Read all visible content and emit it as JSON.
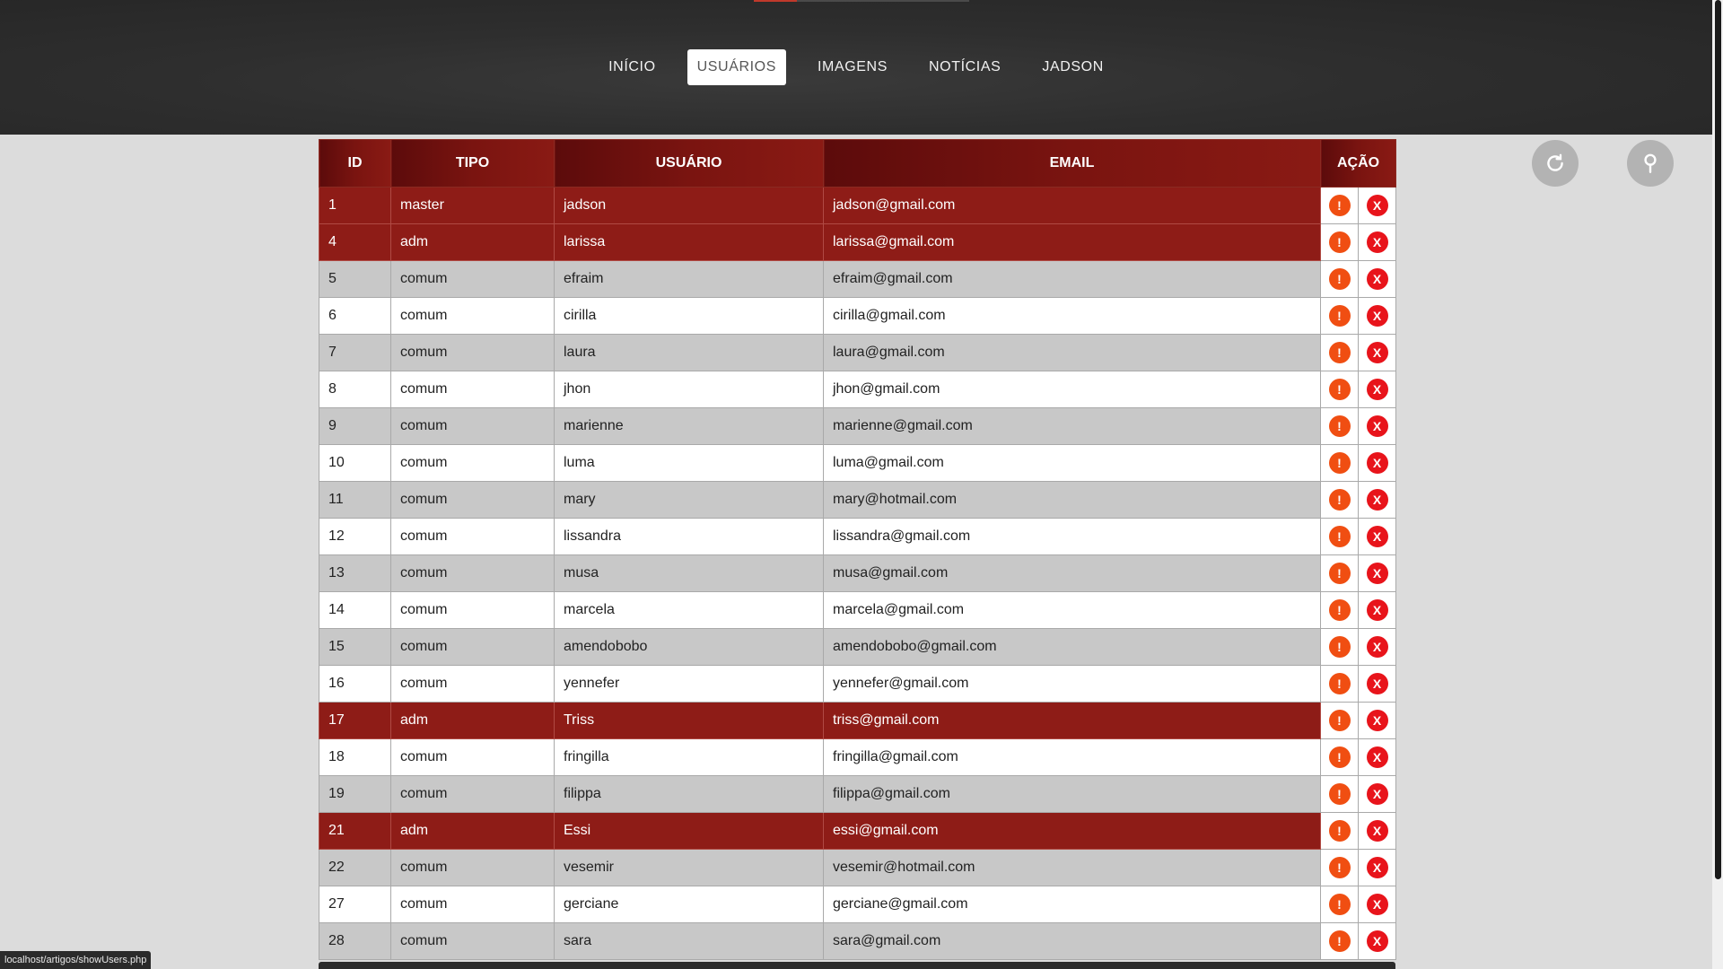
{
  "nav": [
    {
      "label": "INÍCIO",
      "active": false
    },
    {
      "label": "USUÁRIOS",
      "active": true
    },
    {
      "label": "IMAGENS",
      "active": false
    },
    {
      "label": "NOTÍCIAS",
      "active": false
    },
    {
      "label": "JADSON",
      "active": false
    }
  ],
  "table": {
    "headers": [
      "ID",
      "TIPO",
      "USUÁRIO",
      "EMAIL",
      "AÇÃO"
    ],
    "action_labels": {
      "warn": "!",
      "delete": "X"
    },
    "rows": [
      {
        "id": "1",
        "tipo": "master",
        "usuario": "jadson",
        "email": "jadson@gmail.com",
        "highlight": true
      },
      {
        "id": "4",
        "tipo": "adm",
        "usuario": "larissa",
        "email": "larissa@gmail.com",
        "highlight": true
      },
      {
        "id": "5",
        "tipo": "comum",
        "usuario": "efraim",
        "email": "efraim@gmail.com",
        "highlight": false
      },
      {
        "id": "6",
        "tipo": "comum",
        "usuario": "cirilla",
        "email": "cirilla@gmail.com",
        "highlight": false
      },
      {
        "id": "7",
        "tipo": "comum",
        "usuario": "laura",
        "email": "laura@gmail.com",
        "highlight": false
      },
      {
        "id": "8",
        "tipo": "comum",
        "usuario": "jhon",
        "email": "jhon@gmail.com",
        "highlight": false
      },
      {
        "id": "9",
        "tipo": "comum",
        "usuario": "marienne",
        "email": "marienne@gmail.com",
        "highlight": false
      },
      {
        "id": "10",
        "tipo": "comum",
        "usuario": "luma",
        "email": "luma@gmail.com",
        "highlight": false
      },
      {
        "id": "11",
        "tipo": "comum",
        "usuario": "mary",
        "email": "mary@hotmail.com",
        "highlight": false
      },
      {
        "id": "12",
        "tipo": "comum",
        "usuario": "lissandra",
        "email": "lissandra@gmail.com",
        "highlight": false
      },
      {
        "id": "13",
        "tipo": "comum",
        "usuario": "musa",
        "email": "musa@gmail.com",
        "highlight": false
      },
      {
        "id": "14",
        "tipo": "comum",
        "usuario": "marcela",
        "email": "marcela@gmail.com",
        "highlight": false
      },
      {
        "id": "15",
        "tipo": "comum",
        "usuario": "amendobobo",
        "email": "amendobobo@gmail.com",
        "highlight": false
      },
      {
        "id": "16",
        "tipo": "comum",
        "usuario": "yennefer",
        "email": "yennefer@gmail.com",
        "highlight": false
      },
      {
        "id": "17",
        "tipo": "adm",
        "usuario": "Triss",
        "email": "triss@gmail.com",
        "highlight": true
      },
      {
        "id": "18",
        "tipo": "comum",
        "usuario": "fringilla",
        "email": "fringilla@gmail.com",
        "highlight": false
      },
      {
        "id": "19",
        "tipo": "comum",
        "usuario": "filippa",
        "email": "filippa@gmail.com",
        "highlight": false
      },
      {
        "id": "21",
        "tipo": "adm",
        "usuario": "Essi",
        "email": "essi@gmail.com",
        "highlight": true
      },
      {
        "id": "22",
        "tipo": "comum",
        "usuario": "vesemir",
        "email": "vesemir@hotmail.com",
        "highlight": false
      },
      {
        "id": "27",
        "tipo": "comum",
        "usuario": "gerciane",
        "email": "gerciane@gmail.com",
        "highlight": false
      },
      {
        "id": "28",
        "tipo": "comum",
        "usuario": "sara",
        "email": "sara@gmail.com",
        "highlight": false
      }
    ]
  },
  "buttons": {
    "refresh_icon": "refresh-icon",
    "search_icon": "search-icon"
  },
  "statusbar": {
    "url": "localhost/artigos/showUsers.php"
  },
  "colors": {
    "header_bg": "#2e2e2e",
    "highlight_row": "#8e1c17",
    "warn": "#f04e12",
    "delete": "#e8141b"
  }
}
